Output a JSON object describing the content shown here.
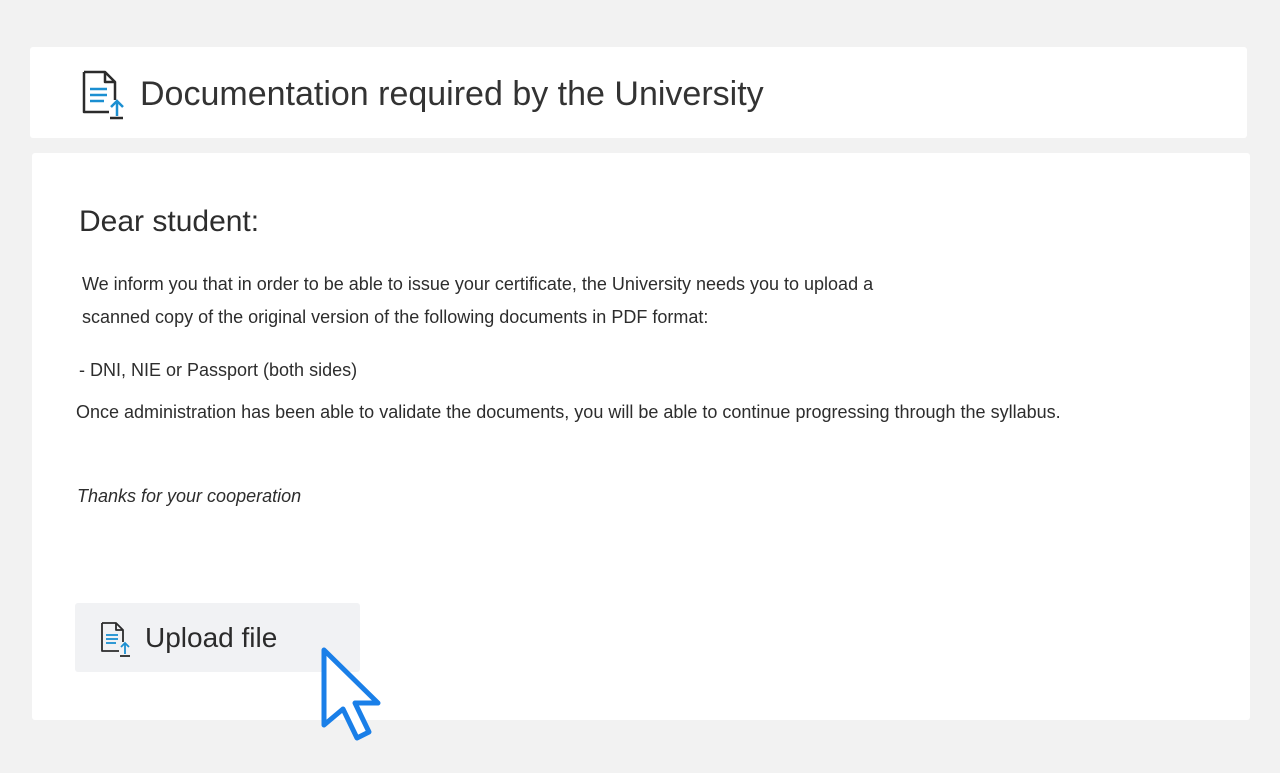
{
  "header": {
    "title": "Documentation required by the University",
    "icon": "document-upload-icon"
  },
  "content": {
    "greeting": "Dear student:",
    "paragraph_line1": "We inform you that in order to be able to issue your certificate, the University needs you to upload a",
    "paragraph_line2": "scanned copy of the original version of the following documents in PDF format:",
    "document_item": "- DNI, NIE or Passport (both sides)",
    "validation_note": "Once administration has been able to validate the documents, you will be able to continue progressing through the syllabus.",
    "thanks": "Thanks for your cooperation"
  },
  "upload": {
    "label": "Upload file",
    "icon": "document-upload-icon"
  },
  "colors": {
    "background": "#f2f2f2",
    "card": "#ffffff",
    "icon_outline": "#2b2b2b",
    "icon_accent": "#1b8fd1",
    "button_background": "#f1f2f4",
    "cursor_outline": "#1a7fe8"
  },
  "cursor": "arrow-cursor-icon"
}
